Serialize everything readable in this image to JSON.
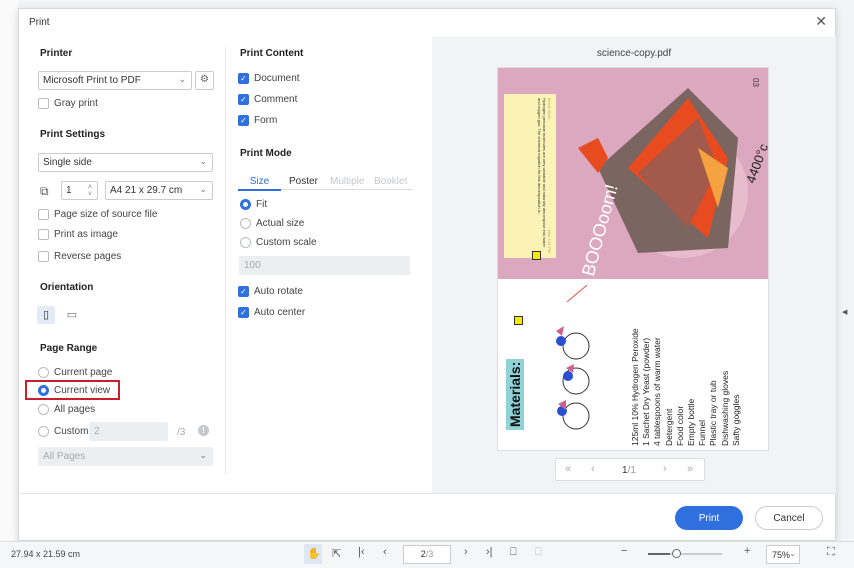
{
  "dialog": {
    "title": "Print",
    "close_icon": "close-icon"
  },
  "printer": {
    "heading": "Printer",
    "selected": "Microsoft Print to PDF",
    "gray_print": "Gray print",
    "gray_checked": false
  },
  "settings": {
    "heading": "Print Settings",
    "sides": "Single side",
    "copies": "1",
    "paper": "A4 21 x 29.7 cm",
    "options": [
      {
        "label": "Page size of source file",
        "checked": false
      },
      {
        "label": "Print as image",
        "checked": false
      },
      {
        "label": "Reverse pages",
        "checked": false
      }
    ]
  },
  "orientation": {
    "heading": "Orientation",
    "selected": "portrait"
  },
  "page_range": {
    "heading": "Page Range",
    "options": [
      {
        "label": "Current page",
        "selected": false
      },
      {
        "label": "Current view",
        "selected": true
      },
      {
        "label": "All pages",
        "selected": false
      },
      {
        "label": "Custom",
        "selected": false
      }
    ],
    "custom_value": "2",
    "custom_total": "/3",
    "subset": "All Pages"
  },
  "content": {
    "heading": "Print Content",
    "items": [
      {
        "label": "Document",
        "checked": true
      },
      {
        "label": "Comment",
        "checked": true
      },
      {
        "label": "Form",
        "checked": true
      }
    ]
  },
  "mode": {
    "heading": "Print Mode",
    "tabs": [
      {
        "label": "Size",
        "active": true,
        "enabled": true
      },
      {
        "label": "Poster",
        "enabled": true
      },
      {
        "label": "Multiple",
        "enabled": false
      },
      {
        "label": "Booklet",
        "enabled": false
      }
    ],
    "sizes": [
      {
        "label": "Fit",
        "selected": true
      },
      {
        "label": "Actual size",
        "selected": false
      },
      {
        "label": "Custom scale",
        "selected": false
      }
    ],
    "scale": "100",
    "auto_rotate": "Auto rotate",
    "auto_center": "Auto center"
  },
  "preview": {
    "filename": "science-copy.pdf",
    "page_indicator": "1",
    "page_total": "/1",
    "page_content": {
      "page_no": "03",
      "note_author": "Brook Wells",
      "note_time": "Mon 4:11 PM",
      "note_text": "Hydrogen peroxide molecules are very unstable and naturally decompose into water and oxygen gas. The chemical equation for this decomposition is:",
      "boom": "BOOOoom!",
      "temp": "4400°c",
      "materials_title": "Materials:",
      "materials": [
        "125ml 10% Hydrogen Peroxide",
        "1 Sachet Dry Yeast (powder)",
        "4 tablespoons of warm water",
        "Detergent",
        "Food color",
        "Empty bottle",
        "Funnel",
        "Plastic tray or tub",
        "Dishwashing gloves",
        "Safty goggles"
      ]
    }
  },
  "actions": {
    "print": "Print",
    "cancel": "Cancel"
  },
  "statusbar": {
    "page_size": "27.94 x 21.59 cm",
    "page_current": "2",
    "page_total": "/3",
    "zoom": "75%",
    "zoom_fraction": 0.3
  },
  "colors": {
    "accent": "#2f6fde",
    "highlight_box": "#c8202a",
    "page_pink": "#dba8bf"
  }
}
